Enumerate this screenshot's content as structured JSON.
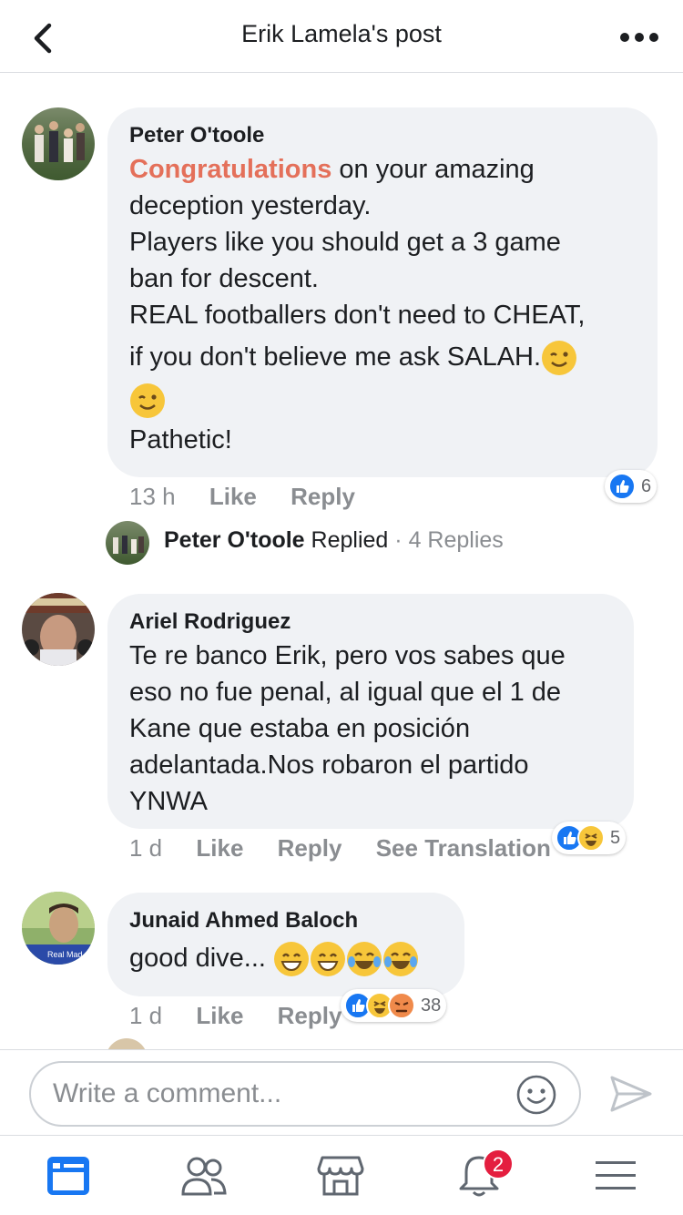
{
  "header": {
    "title": "Erik Lamela's post"
  },
  "comments": [
    {
      "author": "Peter O'toole",
      "highlight": "Congratulations",
      "lines": [
        " on your amazing",
        "deception yesterday.",
        "Players like you should get a 3 game",
        "ban for descent.",
        "REAL footballers don't need to CHEAT,",
        "if you don't believe me ask SALAH.",
        "Pathetic!"
      ],
      "time": "13 h",
      "like": "Like",
      "reply": "Reply",
      "reactions": "6",
      "replies": {
        "author": "Peter O'toole",
        "action": "Replied",
        "sep": "·",
        "count": "4 Replies"
      }
    },
    {
      "author": "Ariel Rodriguez",
      "lines": [
        "Te re banco Erik, pero vos sabes que",
        "eso no fue penal, al igual que el 1 de",
        "Kane que estaba en posición",
        "adelantada.Nos robaron el partido",
        "YNWA"
      ],
      "time": "1 d",
      "like": "Like",
      "reply": "Reply",
      "translate": "See Translation",
      "reactions": "5"
    },
    {
      "author": "Junaid Ahmed Baloch",
      "avatar_caption": "Real Mad",
      "text": "good dive...",
      "time": "1 d",
      "like": "Like",
      "reply": "Reply",
      "reactions": "38"
    }
  ],
  "composer": {
    "placeholder": "Write a comment..."
  },
  "tabbar": {
    "notifications_badge": "2"
  },
  "colors": {
    "accent": "#1877f2",
    "highlight": "#e4705a",
    "badge": "#e41e3f"
  }
}
